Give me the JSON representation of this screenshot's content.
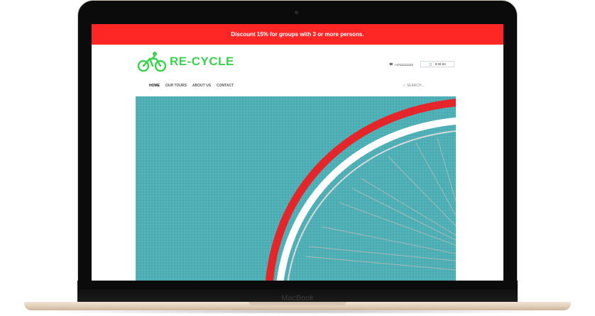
{
  "device": {
    "label": "MacBook"
  },
  "promo": {
    "text": "Discount 15% for groups with 3 or more persons."
  },
  "brand": {
    "name": "RE-CYCLE",
    "color": "#3cd14f"
  },
  "header": {
    "phone": "+4711111222",
    "cart_total": "$ 99.99"
  },
  "nav": {
    "items": [
      "HOME",
      "OUR TOURS",
      "ABOUT US",
      "CONTACT"
    ],
    "active": "HOME"
  },
  "search": {
    "placeholder": "SEARCH..."
  },
  "colors": {
    "promo_bg": "#ff2626",
    "hero_bg": "#4eb0b6",
    "wheel_red": "#e4262a"
  },
  "hero": {
    "image_icon": "bicycle-wheel-image"
  }
}
